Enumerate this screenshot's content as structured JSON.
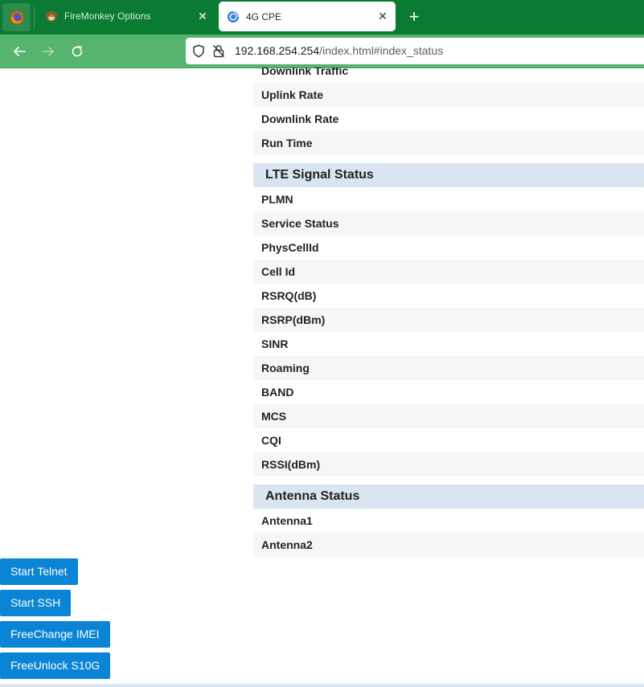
{
  "browser": {
    "tabs": [
      {
        "title": "FireMonkey Options",
        "icon": "monkey-icon",
        "active": false
      },
      {
        "title": "4G CPE",
        "icon": "globe-icon",
        "active": true
      }
    ],
    "url_host": "192.168.254.254",
    "url_path": "/index.html#index_status"
  },
  "status": {
    "top_rows": [
      "Downlink Traffic",
      "Uplink Rate",
      "Downlink Rate",
      "Run Time"
    ],
    "lte_section": {
      "title": "LTE Signal Status",
      "rows": [
        "PLMN",
        "Service Status",
        "PhysCellId",
        "Cell Id",
        "RSRQ(dB)",
        "RSRP(dBm)",
        "SINR",
        "Roaming",
        "BAND",
        "MCS",
        "CQI",
        "RSSI(dBm)"
      ]
    },
    "antenna_section": {
      "title": "Antenna Status",
      "rows": [
        "Antenna1",
        "Antenna2"
      ]
    }
  },
  "actions": {
    "telnet": "Start Telnet",
    "ssh": "Start SSH",
    "imei": "FreeChange IMEI",
    "unlock": "FreeUnlock S10G"
  },
  "colors": {
    "tabbar": "#0b7a33",
    "navbar": "#57b46e",
    "section_header": "#dae5f1",
    "button": "#0b84d6"
  }
}
